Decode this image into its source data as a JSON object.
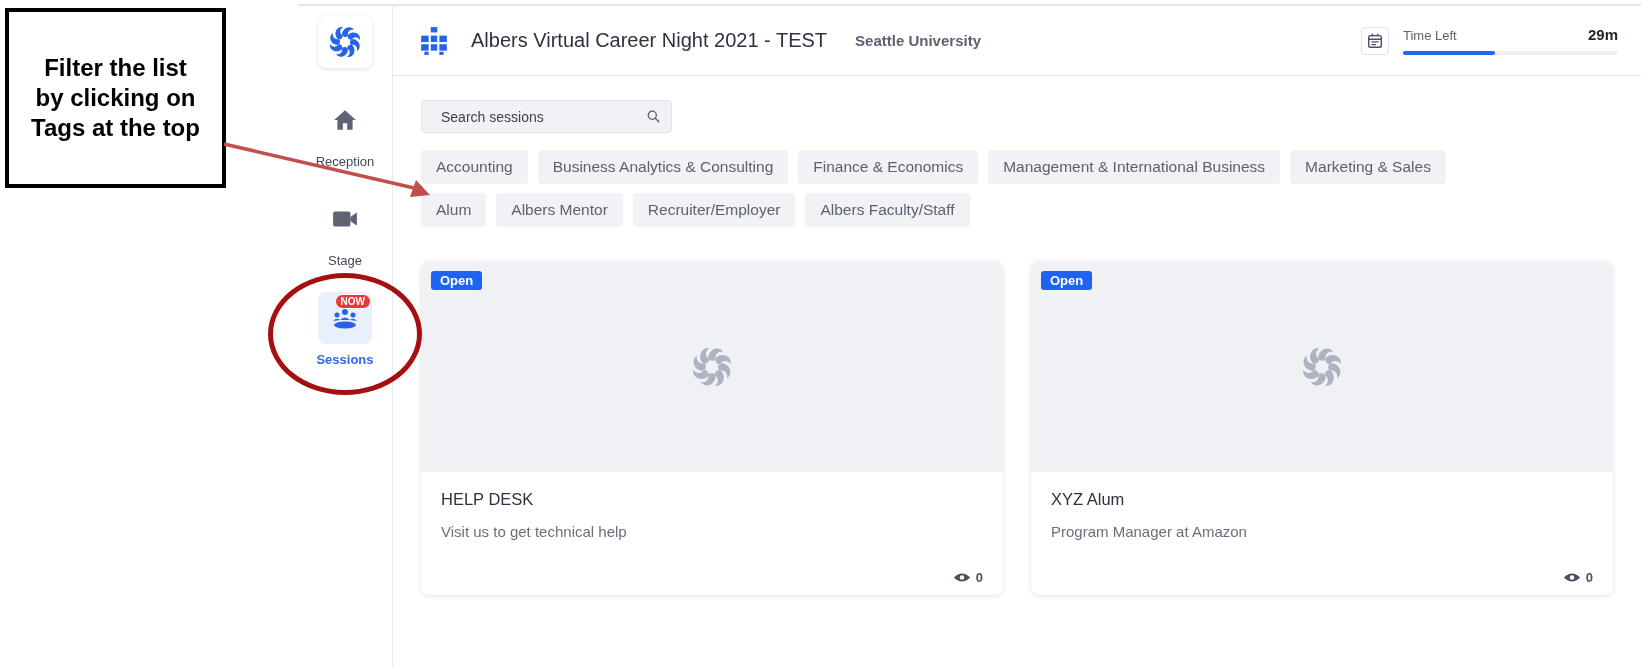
{
  "annotation": {
    "text": "Filter the list by clicking on Tags at the top"
  },
  "sidebar": {
    "items": [
      {
        "label": "Reception",
        "kind": "home",
        "selected": false
      },
      {
        "label": "Stage",
        "kind": "video",
        "selected": false
      },
      {
        "label": "Sessions",
        "kind": "sessions",
        "selected": true,
        "badge": "NOW"
      }
    ]
  },
  "header": {
    "title": "Albers Virtual Career Night 2021 - TEST",
    "organizer": "Seattle University",
    "timer": {
      "label": "Time Left",
      "value": "29m",
      "level": 0.43
    }
  },
  "search": {
    "placeholder": "Search sessions"
  },
  "tag_rows": [
    [
      "Accounting",
      "Business Analytics & Consulting",
      "Finance & Economics",
      "Management & International Business",
      "Marketing & Sales"
    ],
    [
      "Alum",
      "Albers Mentor",
      "Recruiter/Employer",
      "Albers Faculty/Staff"
    ]
  ],
  "sessions": [
    {
      "status": "Open",
      "title": "HELP DESK",
      "description": "Visit us to get technical help",
      "views": "0"
    },
    {
      "status": "Open",
      "title": "XYZ Alum",
      "description": "Program Manager at Amazon",
      "views": "0"
    }
  ]
}
